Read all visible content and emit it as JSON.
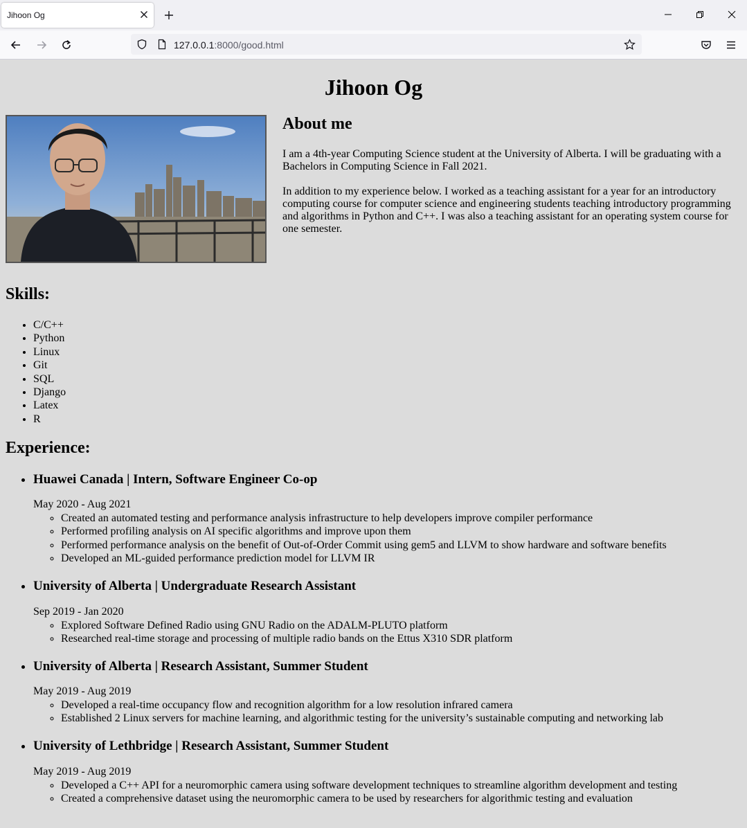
{
  "browser": {
    "tab_title": "Jihoon Og",
    "url_host": "127.0.0.1",
    "url_rest": ":8000/good.html"
  },
  "page": {
    "name": "Jihoon Og",
    "about": {
      "heading": "About me",
      "p1": "I am a 4th-year Computing Science student at the University of Alberta. I will be graduating with a Bachelors in Computing Science in Fall 2021.",
      "p2": "In addition to my experience below. I worked as a teaching assistant for a year for an introductory computing course for computer science and engineering students teaching introductory programming and algorithms in Python and C++. I was also a teaching assistant for an operating system course for one semester."
    },
    "skills_heading": "Skills:",
    "skills": [
      "C/C++",
      "Python",
      "Linux",
      "Git",
      "SQL",
      "Django",
      "Latex",
      "R"
    ],
    "experience_heading": "Experience:",
    "experience": [
      {
        "title": "Huawei Canada | Intern, Software Engineer Co-op",
        "dates": "May 2020 - Aug 2021",
        "bullets": [
          "Created an automated testing and performance analysis infrastructure to help developers improve compiler performance",
          "Performed profiling analysis on AI specific algorithms and improve upon them",
          "Performed performance analysis on the benefit of Out-of-Order Commit using gem5 and LLVM to show hardware and software benefits",
          "Developed an ML-guided performance prediction model for LLVM IR"
        ]
      },
      {
        "title": "University of Alberta | Undergraduate Research Assistant",
        "dates": "Sep 2019 - Jan 2020",
        "bullets": [
          "Explored Software Defined Radio using GNU Radio on the ADALM-PLUTO platform",
          "Researched real-time storage and processing of multiple radio bands on the Ettus X310 SDR platform"
        ]
      },
      {
        "title": "University of Alberta | Research Assistant, Summer Student",
        "dates": "May 2019 - Aug 2019",
        "bullets": [
          "Developed a real-time occupancy flow and recognition algorithm for a low resolution infrared camera",
          "Established 2 Linux servers for machine learning, and algorithmic testing for the university’s sustainable computing and networking lab"
        ]
      },
      {
        "title": "University of Lethbridge | Research Assistant, Summer Student",
        "dates": "May 2019 - Aug 2019",
        "bullets": [
          "Developed a C++ API for a neuromorphic camera using software development techniques to streamline algorithm development and testing",
          "Created a comprehensive dataset using the neuromorphic camera to be used by researchers for algorithmic testing and evaluation"
        ]
      }
    ]
  },
  "icons": {
    "tab_close": "close-icon",
    "new_tab": "plus-icon",
    "minimize": "minimize-icon",
    "restore": "restore-icon",
    "close_window": "close-window-icon",
    "back": "back-arrow-icon",
    "forward": "forward-arrow-icon",
    "reload": "reload-icon",
    "shield": "shield-icon",
    "page": "page-icon",
    "star": "star-icon",
    "pocket": "pocket-icon",
    "menu": "hamburger-menu-icon"
  }
}
